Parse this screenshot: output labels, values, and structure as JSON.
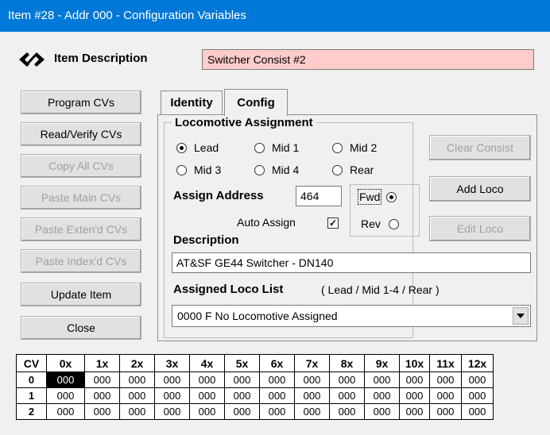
{
  "window": {
    "title": "Item #28 - Addr 000 - Configuration Variables"
  },
  "item": {
    "label": "Item Description",
    "value": "Switcher Consist #2"
  },
  "left_buttons": [
    {
      "label": "Program CVs",
      "enabled": true
    },
    {
      "label": "Read/Verify CVs",
      "enabled": true
    },
    {
      "label": "Copy All CVs",
      "enabled": false
    },
    {
      "label": "Paste Main CVs",
      "enabled": false
    },
    {
      "label": "Paste Exten'd CVs",
      "enabled": false
    },
    {
      "label": "Paste Index'd CVs",
      "enabled": false
    },
    {
      "label": "Update Item",
      "enabled": true
    },
    {
      "label": "Close",
      "enabled": true
    }
  ],
  "tabs": [
    {
      "label": "Identity"
    },
    {
      "label": "Config",
      "active": true
    }
  ],
  "config": {
    "group_title": "Locomotive Assignment",
    "positions": [
      {
        "label": "Lead",
        "checked": true
      },
      {
        "label": "Mid 1",
        "checked": false
      },
      {
        "label": "Mid 2",
        "checked": false
      },
      {
        "label": "Mid 3",
        "checked": false
      },
      {
        "label": "Mid 4",
        "checked": false
      },
      {
        "label": "Rear",
        "checked": false
      }
    ],
    "assign_address_label": "Assign Address",
    "assign_address_value": "464",
    "auto_assign_label": "Auto Assign",
    "auto_assign_checked": true,
    "fwd_label": "Fwd",
    "rev_label": "Rev",
    "direction": "Fwd",
    "description_label": "Description",
    "description_value": "AT&SF GE44 Switcher - DN140",
    "list_label": "Assigned Loco List",
    "list_hint": "( Lead / Mid 1-4 / Rear )",
    "list_selected": "0000 F  No Locomotive Assigned",
    "clear_consist": "Clear Consist",
    "add_loco": "Add Loco",
    "edit_loco": "Edit Loco"
  },
  "cv_table": {
    "corner": "CV",
    "columns": [
      "0x",
      "1x",
      "2x",
      "3x",
      "4x",
      "5x",
      "6x",
      "7x",
      "8x",
      "9x",
      "10x",
      "11x",
      "12x"
    ],
    "rows": [
      {
        "label": "0",
        "values": [
          "000",
          "000",
          "000",
          "000",
          "000",
          "000",
          "000",
          "000",
          "000",
          "000",
          "000",
          "000",
          "000"
        ]
      },
      {
        "label": "1",
        "values": [
          "000",
          "000",
          "000",
          "000",
          "000",
          "000",
          "000",
          "000",
          "000",
          "000",
          "000",
          "000",
          "000"
        ]
      },
      {
        "label": "2",
        "values": [
          "000",
          "000",
          "000",
          "000",
          "000",
          "000",
          "000",
          "000",
          "000",
          "000",
          "000",
          "000",
          "000"
        ]
      }
    ]
  }
}
